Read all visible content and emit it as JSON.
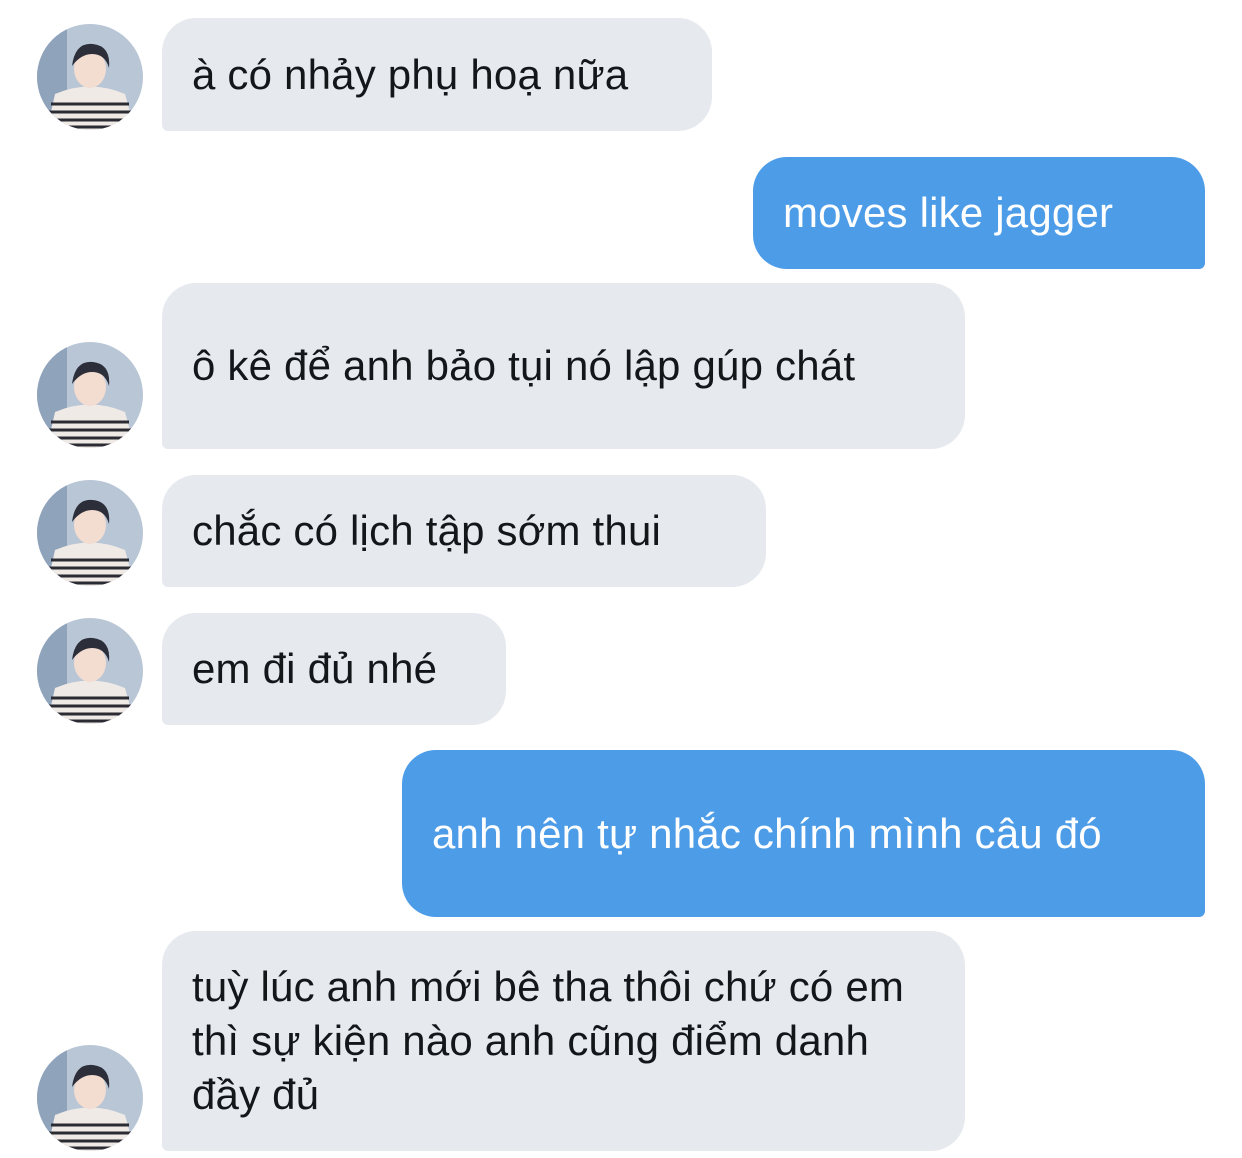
{
  "conversation": {
    "messages": [
      {
        "direction": "received",
        "text": "à có nhảy phụ hoạ nữa",
        "has_avatar": true
      },
      {
        "direction": "sent",
        "text": "moves like jagger",
        "has_avatar": false
      },
      {
        "direction": "received",
        "text": "ô kê để anh bảo tụi nó lập gúp chát",
        "has_avatar": true
      },
      {
        "direction": "received",
        "text": "chắc có lịch tập sớm thui",
        "has_avatar": true
      },
      {
        "direction": "received",
        "text": "em đi đủ nhé",
        "has_avatar": true
      },
      {
        "direction": "sent",
        "text": "anh nên tự nhắc chính mình câu đó",
        "has_avatar": false
      },
      {
        "direction": "received",
        "text": "tuỳ lúc anh mới bê tha thôi chứ có em thì sự kiện nào anh cũng điểm danh đầy đủ",
        "has_avatar": true
      }
    ]
  },
  "colors": {
    "received_bubble": "#e6e9ee",
    "received_text": "#14171a",
    "sent_bubble": "#4d9ce8",
    "sent_text": "#ffffff",
    "background": "#ffffff"
  },
  "icons": {
    "sender_avatar": "profile-photo-avatar"
  }
}
